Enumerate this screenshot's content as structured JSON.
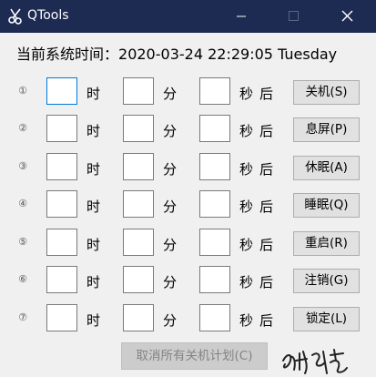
{
  "window": {
    "title": "QTools",
    "icon": "scissors-icon",
    "controls": [
      "minimize-icon",
      "maximize-icon",
      "close-icon"
    ]
  },
  "time_display": {
    "label": "当前系统时间：",
    "value": "2020-03-24 22:29:05 Tuesday"
  },
  "units": {
    "hour": "时",
    "minute": "分",
    "second": "秒",
    "after": "后"
  },
  "rows": [
    {
      "num": "①",
      "hour": "",
      "minute": "",
      "second": "",
      "action": "关机(S)"
    },
    {
      "num": "②",
      "hour": "",
      "minute": "",
      "second": "",
      "action": "息屏(P)"
    },
    {
      "num": "③",
      "hour": "",
      "minute": "",
      "second": "",
      "action": "休眠(A)"
    },
    {
      "num": "④",
      "hour": "",
      "minute": "",
      "second": "",
      "action": "睡眠(Q)"
    },
    {
      "num": "⑤",
      "hour": "",
      "minute": "",
      "second": "",
      "action": "重启(R)"
    },
    {
      "num": "⑥",
      "hour": "",
      "minute": "",
      "second": "",
      "action": "注销(G)"
    },
    {
      "num": "⑦",
      "hour": "",
      "minute": "",
      "second": "",
      "action": "锁定(L)"
    }
  ],
  "cancel_button": {
    "label": "取消所有关机计划(C)",
    "enabled": false
  },
  "colors": {
    "titlebar": "#1d2a52",
    "focus": "#0078d7",
    "button_bg": "#e1e1e1",
    "client_bg": "#f0f0f0"
  }
}
